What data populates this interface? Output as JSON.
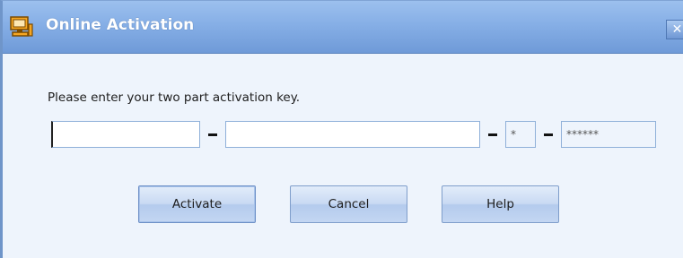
{
  "window": {
    "title": "Online Activation",
    "close_glyph": "✕",
    "icon": "monitor-icon"
  },
  "form": {
    "prompt": "Please enter your two part activation key.",
    "key_part_1": "",
    "key_part_2": "",
    "key_part_3": "*",
    "key_part_4": "******"
  },
  "buttons": {
    "activate": "Activate",
    "cancel": "Cancel",
    "help": "Help"
  },
  "colors": {
    "titlebar": "#86afe6",
    "body": "#eef4fc",
    "field_border": "#8fb0d9"
  }
}
